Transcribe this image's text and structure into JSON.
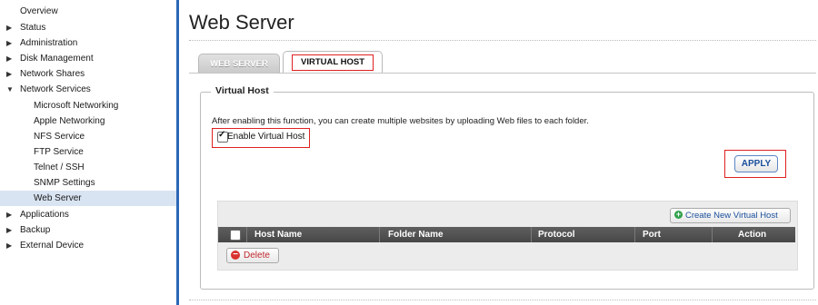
{
  "sidebar": {
    "items": [
      {
        "label": "Overview",
        "arrow": ""
      },
      {
        "label": "Status",
        "arrow": "▶"
      },
      {
        "label": "Administration",
        "arrow": "▶"
      },
      {
        "label": "Disk Management",
        "arrow": "▶"
      },
      {
        "label": "Network Shares",
        "arrow": "▶"
      },
      {
        "label": "Network Services",
        "arrow": "▼"
      },
      {
        "label": "Microsoft Networking"
      },
      {
        "label": "Apple Networking"
      },
      {
        "label": "NFS Service"
      },
      {
        "label": "FTP Service"
      },
      {
        "label": "Telnet / SSH"
      },
      {
        "label": "SNMP Settings"
      },
      {
        "label": "Web Server",
        "selected": true
      },
      {
        "label": "Applications",
        "arrow": "▶"
      },
      {
        "label": "Backup",
        "arrow": "▶"
      },
      {
        "label": "External Device",
        "arrow": "▶"
      }
    ]
  },
  "main": {
    "title": "Web Server",
    "tabs": [
      {
        "label": "WEB SERVER",
        "active": false
      },
      {
        "label": "VIRTUAL HOST",
        "active": true
      }
    ],
    "section_legend": "Virtual Host",
    "description": "After enabling this function, you can create multiple websites by uploading Web files to each folder.",
    "enable_checkbox": {
      "label": "Enable Virtual Host",
      "checked": true
    },
    "apply_label": "APPLY",
    "grid": {
      "create_label": "Create New Virtual Host",
      "columns": [
        "Host Name",
        "Folder Name",
        "Protocol",
        "Port",
        "Action"
      ],
      "rows": [],
      "delete_label": "Delete"
    }
  },
  "colors": {
    "accent": "#2b68b6",
    "highlight_outline": "#e02020",
    "header_bg": "#4f4f4f",
    "selected_nav": "#d9e4f2"
  },
  "icons": {
    "collapsed": "triangle-right-icon",
    "expanded": "triangle-down-icon",
    "create": "plus-circle-icon",
    "delete": "minus-circle-icon"
  }
}
